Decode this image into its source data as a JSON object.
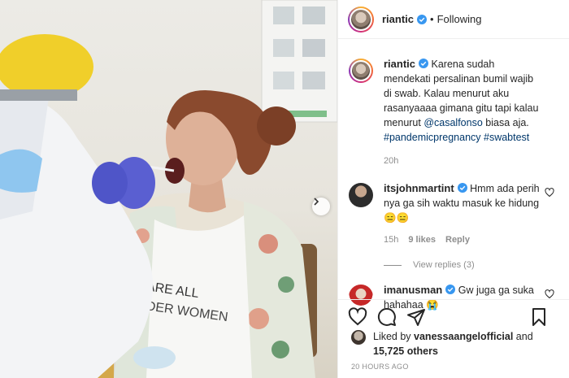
{
  "header": {
    "username": "riantic",
    "separator": "•",
    "follow_label": "Following"
  },
  "caption": {
    "username": "riantic",
    "text_before": "Karena sudah mendekati persalinan bumil wajib di swab. Kalau menurut aku rasanyaaaa gimana gitu tapi kalau menurut ",
    "mention": "@casalfonso",
    "text_after": " biasa aja. ",
    "hashtags": "#pandemicpregnancy #swabtest",
    "age": "20h"
  },
  "comments": [
    {
      "username": "itsjohnmartint",
      "text": "Hmm ada perih nya ga sih waktu masuk ke hidung",
      "emoji": "😑😑",
      "age": "15h",
      "likes": "9 likes",
      "reply_label": "Reply",
      "view_replies": "View replies (3)"
    },
    {
      "username": "imanusman",
      "text": "Gw juga ga suka hahahaa",
      "emoji": "😭"
    }
  ],
  "actions": {
    "like_icon": "heart-icon",
    "comment_icon": "comment-icon",
    "share_icon": "share-icon",
    "save_icon": "bookmark-icon"
  },
  "likes": {
    "prefix": "Liked by ",
    "user": "vanessaangelofficial",
    "middle": " and",
    "count": "15,725 others"
  },
  "timestamp": "20 HOURS AGO",
  "photo": {
    "shirt_text_line1": "WE ARE ALL",
    "shirt_text_line2": "WONDER WOMEN"
  },
  "colors": {
    "verified": "#3897f0",
    "link": "#00376b",
    "muted": "#8e8e8e"
  }
}
